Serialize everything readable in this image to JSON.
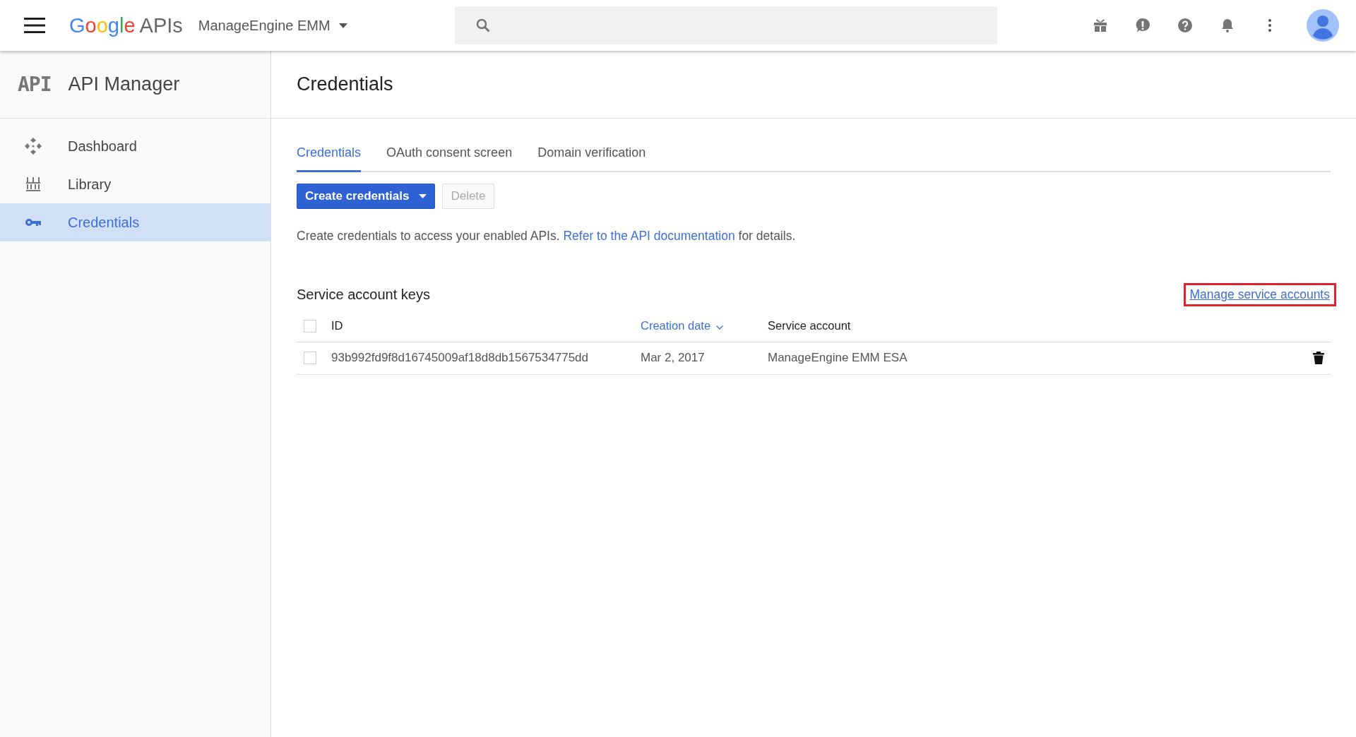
{
  "top_bar": {
    "logo": {
      "brand": "Google",
      "product": "APIs"
    },
    "project": "ManageEngine EMM"
  },
  "sidebar": {
    "title_icon": "API",
    "title": "API Manager",
    "items": [
      {
        "label": "Dashboard",
        "kind": "dashboard",
        "selected": false
      },
      {
        "label": "Library",
        "kind": "library",
        "selected": false
      },
      {
        "label": "Credentials",
        "kind": "key",
        "selected": true
      }
    ]
  },
  "page": {
    "title": "Credentials",
    "tabs": [
      {
        "label": "Credentials",
        "selected": true
      },
      {
        "label": "OAuth consent screen",
        "selected": false
      },
      {
        "label": "Domain verification",
        "selected": false
      }
    ],
    "buttons": [
      {
        "label": "Create credentials",
        "kind": "dropdown",
        "disabled": false
      },
      {
        "label": "Delete",
        "kind": "plain",
        "disabled": true
      }
    ],
    "description": {
      "before": "Create credentials to access your enabled APIs.",
      "link": "Refer to the API documentation",
      "after": "for details."
    },
    "section": {
      "title": "Service account keys",
      "link": {
        "label": "Manage service accounts",
        "highlighted": true
      },
      "table": {
        "columns": [
          {
            "label": "ID",
            "sorted": false
          },
          {
            "label": "Creation date",
            "sorted": true
          },
          {
            "label": "Service account",
            "sorted": false
          }
        ],
        "header_checked": false,
        "rows": [
          {
            "checked": false,
            "cells": [
              "93b992fd9f8d16745009af18d8db1567534775dd",
              "Mar 2, 2017",
              "ManageEngine EMM ESA"
            ]
          }
        ]
      }
    }
  }
}
